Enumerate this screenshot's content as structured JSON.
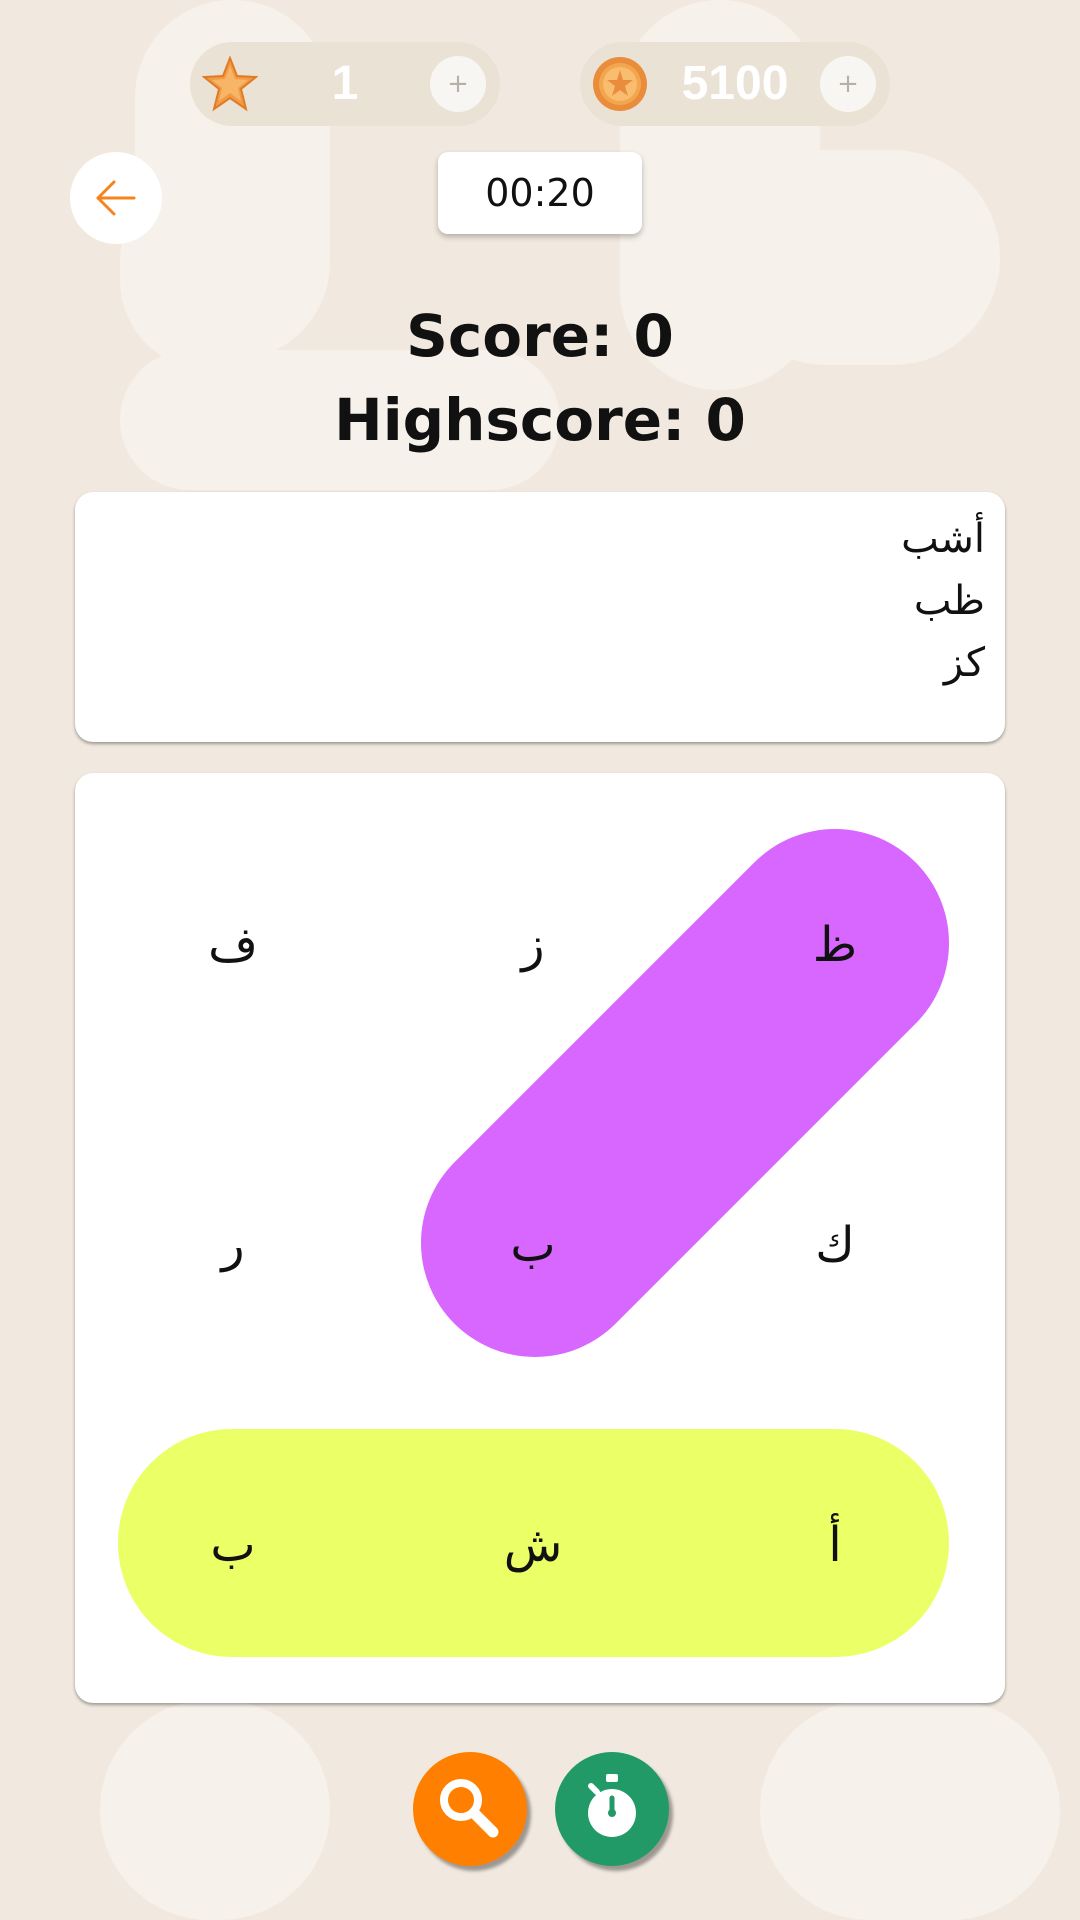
{
  "header": {
    "stars": {
      "value": "1",
      "add_label": "+"
    },
    "coins": {
      "value": "5100",
      "add_label": "+"
    }
  },
  "timer": "00:20",
  "score_text": "Score: 0",
  "highscore_text": "Highscore: 0",
  "words": [
    "أشب",
    "ظب",
    "كز"
  ],
  "grid": {
    "rows": [
      [
        "ف",
        "ز",
        "ظ"
      ],
      [
        "ر",
        "ب",
        "ك"
      ],
      [
        "ب",
        "ش",
        "أ"
      ]
    ],
    "found_colors": [
      "#d767ff",
      "#ebff66"
    ]
  },
  "tools": {
    "search_color": "#ff8000",
    "timer_color": "#229a68"
  },
  "colors": {
    "background": "#f1e9df",
    "accent_orange": "#f78320"
  }
}
